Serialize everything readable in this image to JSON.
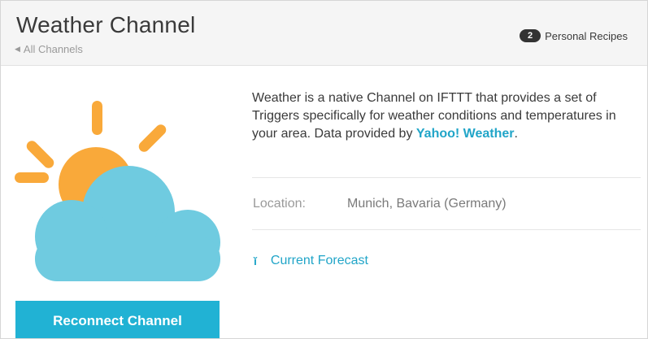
{
  "header": {
    "title": "Weather Channel",
    "back_link": "All Channels",
    "recipes_count": "2",
    "recipes_label": "Personal Recipes"
  },
  "channel": {
    "icon": "sun-behind-cloud-icon",
    "reconnect_label": "Reconnect Channel",
    "description_prefix": "Weather is a native Channel on IFTTT that provides a set of Triggers specifically for weather conditions and temperatures in your area. Data provided by ",
    "provider_link": "Yahoo! Weather",
    "description_suffix": ".",
    "location_label": "Location:",
    "location_value": "Munich, Bavaria (Germany)",
    "forecast_link": "Current Forecast"
  },
  "colors": {
    "accent": "#21b2d4",
    "sun": "#f9a93a",
    "cloud": "#6fcbe0",
    "header_bg": "#f5f5f5"
  }
}
